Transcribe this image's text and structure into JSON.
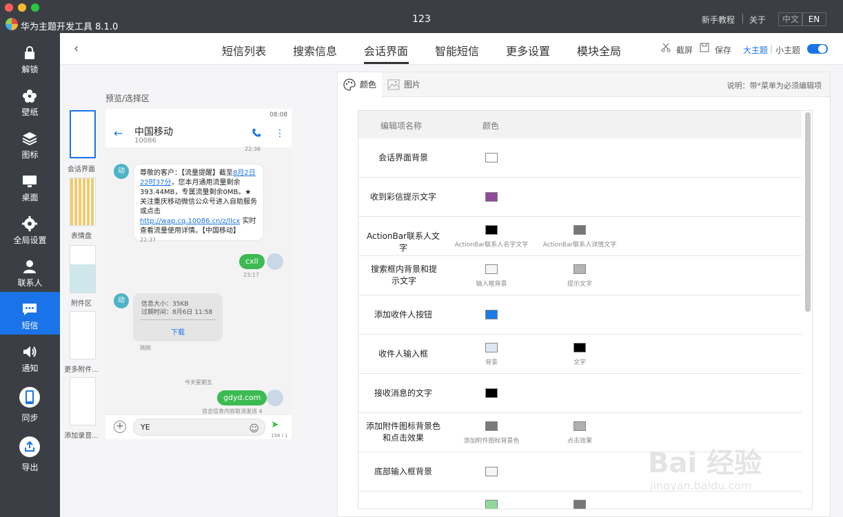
{
  "app": {
    "name": "华为主题开发工具 8.1.0",
    "window_title": "123"
  },
  "titlebar": {
    "tutorial": "新手教程",
    "about": "关于",
    "lang_cn": "中文",
    "lang_en": "EN"
  },
  "sidebar": {
    "items": [
      {
        "label": "解锁",
        "icon": "lock-icon"
      },
      {
        "label": "壁纸",
        "icon": "flower-icon"
      },
      {
        "label": "图标",
        "icon": "layers-icon"
      },
      {
        "label": "桌面",
        "icon": "desktop-icon"
      },
      {
        "label": "全局设置",
        "icon": "gear-icon"
      },
      {
        "label": "联系人",
        "icon": "person-icon"
      },
      {
        "label": "短信",
        "icon": "chat-icon",
        "active": true
      },
      {
        "label": "通知",
        "icon": "speaker-icon"
      },
      {
        "label": "同步",
        "icon": "phone-icon"
      },
      {
        "label": "导出",
        "icon": "export-icon"
      }
    ]
  },
  "topnav": {
    "tabs": [
      "短信列表",
      "搜索信息",
      "会话界面",
      "智能短信",
      "更多设置",
      "模块全局"
    ],
    "active_tab": "会话界面",
    "screenshot": "截屏",
    "save": "保存",
    "big_theme": "大主题",
    "small_theme": "小主题"
  },
  "preview": {
    "title": "预览/选择区",
    "thumbs": [
      "会话界面",
      "表情盘",
      "附件区",
      "更多附件...",
      "添加录音..."
    ]
  },
  "phone": {
    "status": "08:08",
    "contact": "中国移动",
    "number": "10086",
    "time1": "22:36",
    "avatar_label": "动",
    "msg_pre": "尊敬的客户：【流量提醒】截至",
    "msg_date": "8月2日22时37分",
    "msg_mid": "，您本月通用流量剩余393.44MB，专属流量剩余0MB。★关注重庆移动微信公众号进入自助服务或点击",
    "msg_link": "http://wap.cq.10086.cn/z/llcx",
    "msg_post": " 实时查看流量使用详情。【中国移动】",
    "time2": "22:37",
    "out1": "cxll",
    "time3": "23:17",
    "mms_size": "信息大小：35KB",
    "mms_expire": "过期时间：8月6日 11:58",
    "mms_download": "下载",
    "mms_time": "刚刚",
    "day_label": "今天星期五",
    "out2": "gdyd.com",
    "cancel_hint": "双击信息内容取消发送 4",
    "input_value": "YE",
    "char_count": "158 / 1"
  },
  "panel": {
    "tab_color": "颜色",
    "tab_image": "图片",
    "note": "说明：带*菜单为必须编辑项",
    "col_name": "编辑项名称",
    "col_color": "颜色",
    "rows": [
      {
        "name": "会话界面背景",
        "swatches": [
          {
            "color": "#ffffff",
            "label": ""
          }
        ]
      },
      {
        "name": "收到彩信提示文字",
        "swatches": [
          {
            "color": "#8e4b9c",
            "label": ""
          }
        ]
      },
      {
        "name": "ActionBar联系人文字",
        "swatches": [
          {
            "color": "#000000",
            "label": "ActionBar联系人名字文字"
          },
          {
            "color": "#777777",
            "label": "ActionBar联系人详情文字"
          }
        ]
      },
      {
        "name": "搜索框内背景和提示文字",
        "swatches": [
          {
            "color": "#f5f5f5",
            "label": "输入框背景"
          },
          {
            "color": "#b5b5b5",
            "label": "提示文字"
          }
        ]
      },
      {
        "name": "添加收件人按钮",
        "swatches": [
          {
            "color": "#1a7be8",
            "label": ""
          }
        ]
      },
      {
        "name": "收件人输入框",
        "swatches": [
          {
            "color": "#dde7f4",
            "label": "背景"
          },
          {
            "color": "#000000",
            "label": "文字"
          }
        ]
      },
      {
        "name": "接收消息的文字",
        "swatches": [
          {
            "color": "#000000",
            "label": ""
          }
        ]
      },
      {
        "name": "添加附件图标背景色和点击效果",
        "swatches": [
          {
            "color": "#7a7a7a",
            "label": "添加附件图标背景色"
          },
          {
            "color": "#b0b0b0",
            "label": "点击效果"
          }
        ]
      },
      {
        "name": "底部输入框背景",
        "swatches": [
          {
            "color": "#f5f5f5",
            "label": ""
          }
        ]
      }
    ]
  },
  "watermark": {
    "brand": "Bai 经验",
    "url": "jingyan.baidu.com"
  }
}
